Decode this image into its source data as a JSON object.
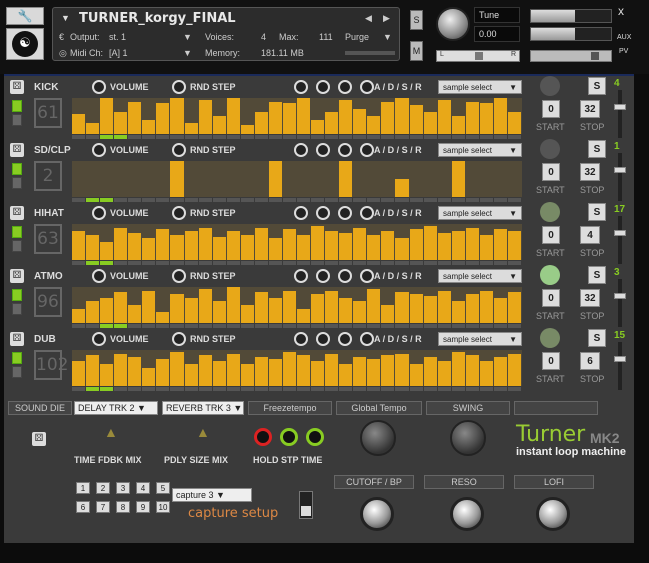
{
  "header": {
    "title": "TURNER_korgy_FINAL",
    "output_label": "Output:",
    "output_value": "st. 1",
    "voices_label": "Voices:",
    "voices_value": "4",
    "max_label": "Max:",
    "max_value": "111",
    "purge_label": "Purge",
    "midi_label": "Midi Ch:",
    "midi_value": "[A]  1",
    "memory_label": "Memory:",
    "memory_value": "181.11 MB",
    "solo_label": "S",
    "mute_label": "M",
    "tune_label": "Tune",
    "tune_value": "0.00",
    "pan_left": "L",
    "pan_right": "R",
    "aux_label": "AUX",
    "pv_label": "PV",
    "close_label": "x"
  },
  "knob_labels": {
    "volume": "VOLUME",
    "rnd_step": "RND STEP",
    "adsr": "A / D / S / R",
    "sample_select": "sample select",
    "start": "START",
    "stop": "STOP"
  },
  "rows": [
    {
      "name": "KICK",
      "number": "61",
      "start": "0",
      "stop": "32",
      "counter": "4",
      "pad_on": true,
      "levels": [
        0.55,
        0.3,
        1.0,
        0.6,
        0.9,
        0.4,
        0.85,
        1.0,
        0.3,
        0.95,
        0.5,
        1.0,
        0.25,
        0.6,
        0.9,
        0.85,
        1.0,
        0.4,
        0.6,
        0.95,
        0.7,
        0.5,
        0.9,
        1.0,
        0.8,
        0.6,
        0.95,
        0.5,
        0.9,
        0.85,
        1.0,
        0.6
      ],
      "step_on": [
        2,
        3
      ]
    },
    {
      "name": "SD/CLP",
      "number": "2",
      "start": "0",
      "stop": "32",
      "counter": "1",
      "pad_on": true,
      "levels": [
        0,
        0,
        0,
        0,
        0,
        0,
        0,
        1.0,
        0,
        0,
        0,
        0,
        0,
        0,
        1.0,
        0,
        0,
        0,
        0,
        1.0,
        0,
        0,
        0,
        0.5,
        0,
        0,
        0,
        1.0,
        0,
        0,
        0,
        0
      ],
      "step_on": [
        1,
        2
      ]
    },
    {
      "name": "HIHAT",
      "number": "63",
      "start": "0",
      "stop": "4",
      "counter": "17",
      "pad_on": true,
      "levels": [
        0.8,
        0.7,
        0.5,
        0.9,
        0.75,
        0.6,
        0.85,
        0.7,
        0.8,
        0.9,
        0.65,
        0.8,
        0.7,
        0.9,
        0.6,
        0.85,
        0.7,
        0.95,
        0.8,
        0.75,
        0.9,
        0.7,
        0.8,
        0.6,
        0.85,
        0.95,
        0.75,
        0.8,
        0.9,
        0.7,
        0.85,
        0.8
      ],
      "step_on": [
        1,
        2
      ]
    },
    {
      "name": "ATMO",
      "number": "96",
      "start": "0",
      "stop": "32",
      "counter": "3",
      "pad_on": true,
      "levels": [
        0.4,
        0.6,
        0.7,
        0.85,
        0.5,
        0.9,
        0.3,
        0.8,
        0.7,
        0.95,
        0.6,
        1.0,
        0.5,
        0.85,
        0.7,
        0.9,
        0.4,
        0.8,
        0.9,
        0.7,
        0.6,
        0.95,
        0.5,
        0.85,
        0.8,
        0.75,
        0.9,
        0.6,
        0.8,
        0.9,
        0.7,
        0.85
      ],
      "step_on": [
        2,
        3
      ]
    },
    {
      "name": "DUB",
      "number": "102",
      "start": "0",
      "stop": "6",
      "counter": "15",
      "pad_on": true,
      "levels": [
        0.7,
        0.85,
        0.6,
        0.9,
        0.8,
        0.5,
        0.75,
        0.95,
        0.6,
        0.85,
        0.7,
        0.9,
        0.6,
        0.8,
        0.75,
        0.95,
        0.85,
        0.7,
        0.9,
        0.6,
        0.8,
        0.75,
        0.85,
        0.9,
        0.6,
        0.8,
        0.7,
        0.95,
        0.85,
        0.7,
        0.8,
        0.9
      ],
      "step_on": [
        1,
        2
      ]
    }
  ],
  "fx": {
    "sound_die": "SOUND DIE",
    "delay": "DELAY TRK 2",
    "reverb": "REVERB TRK 3",
    "freezetempo": "Freezetempo",
    "global_tempo": "Global Tempo",
    "swing": "SWING",
    "delay_params": "TIME FDBK MIX",
    "reverb_params": "PDLY SIZE MIX",
    "hold_params": "HOLD STP TIME"
  },
  "brand": {
    "name": "Turner",
    "version": "MK2",
    "tagline": "instant loop machine"
  },
  "bottom": {
    "presets": [
      "1",
      "2",
      "3",
      "4",
      "5",
      "6",
      "7",
      "8",
      "9",
      "10"
    ],
    "capture_value": "capture 3",
    "capture_setup": "capture setup",
    "cutoff": "CUTOFF / BP",
    "reso": "RESO",
    "lofi": "LOFI"
  },
  "colors": {
    "accent": "#e8a818",
    "green": "#88cc22",
    "seq_bg": "#524a38",
    "panel": "#3a3a3a"
  }
}
